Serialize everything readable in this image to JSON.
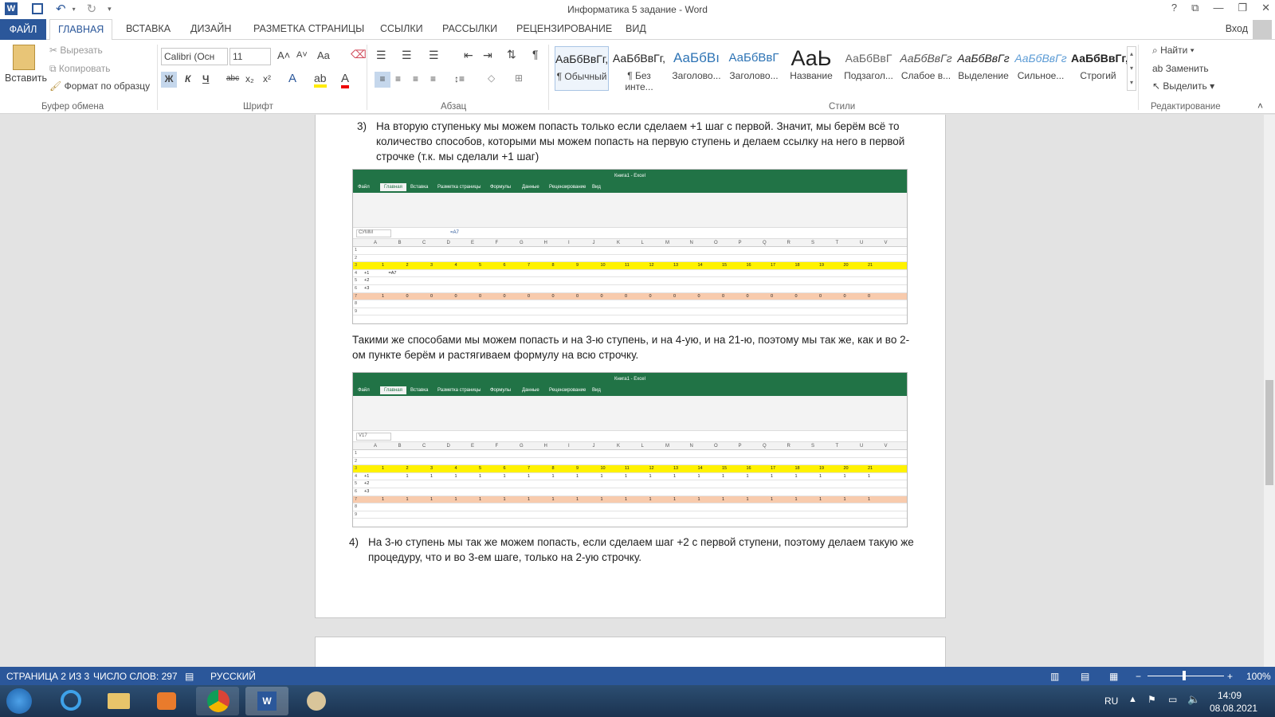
{
  "window": {
    "title": "Информатика 5 задание - Word",
    "sign_in": "Вход"
  },
  "tabs": {
    "file": "ФАЙЛ",
    "items": [
      "ГЛАВНАЯ",
      "ВСТАВКА",
      "ДИЗАЙН",
      "РАЗМЕТКА СТРАНИЦЫ",
      "ССЫЛКИ",
      "РАССЫЛКИ",
      "РЕЦЕНЗИРОВАНИЕ",
      "ВИД"
    ]
  },
  "ribbon": {
    "clipboard": {
      "paste": "Вставить",
      "cut": "Вырезать",
      "copy": "Копировать",
      "format_painter": "Формат по образцу",
      "label": "Буфер обмена"
    },
    "font": {
      "name": "Calibri (Осн",
      "size": "11",
      "label": "Шрифт",
      "bold": "Ж",
      "italic": "К",
      "underline": "Ч",
      "strike": "abc",
      "sub": "x₂",
      "sup": "x²",
      "case": "Aa"
    },
    "paragraph": {
      "label": "Абзац"
    },
    "styles": {
      "label": "Стили",
      "items": [
        {
          "preview": "АаБбВвГг,",
          "name": "¶ Обычный"
        },
        {
          "preview": "АаБбВвГг,",
          "name": "¶ Без инте..."
        },
        {
          "preview": "АаБбВı",
          "name": "Заголово..."
        },
        {
          "preview": "АаБбВвГ",
          "name": "Заголово..."
        },
        {
          "preview": "АаЬ",
          "name": "Название"
        },
        {
          "preview": "АаБбВвГ",
          "name": "Подзагол..."
        },
        {
          "preview": "АаБбВвГг",
          "name": "Слабое в..."
        },
        {
          "preview": "АаБбВвГг",
          "name": "Выделение"
        },
        {
          "preview": "АаБбВвГг",
          "name": "Сильное..."
        },
        {
          "preview": "АаБбВвГг,",
          "name": "Строгий"
        }
      ]
    },
    "editing": {
      "find": "Найти",
      "replace": "Заменить",
      "select": "Выделить",
      "label": "Редактирование"
    }
  },
  "document": {
    "item3_num": "3)",
    "item3_text": "На вторую ступеньку мы можем попасть только если сделаем +1 шаг с первой. Значит, мы берём всё то количество способов, которыми мы можем попасть на первую ступень и делаем ссылку на него в первой строчке (т.к. мы сделали +1 шаг)",
    "para_mid": "Такими же способами мы можем попасть и на 3-ю ступень, и на 4-ую, и на 21-ю, поэтому мы так же, как и во 2-ом пункте берём и растягиваем формулу на всю строчку.",
    "item4_num": "4)",
    "item4_text": "На 3-ю ступень мы так же можем попасть, если сделаем шаг +2 с первой ступени, поэтому делаем такую же процедуру, что и во 3-ем шаге, только на 2-ую строчку."
  },
  "excel1": {
    "title": "Книга1 - Excel",
    "tabs": [
      "Файл",
      "Главная",
      "Вставка",
      "Разметка страницы",
      "Формулы",
      "Данные",
      "Рецензирование",
      "Вид"
    ],
    "namebox": "СУММ",
    "formula": "=A7",
    "columns": [
      "A",
      "B",
      "C",
      "D",
      "E",
      "F",
      "G",
      "H",
      "I",
      "J",
      "K",
      "L",
      "M",
      "N",
      "O",
      "P",
      "Q",
      "R",
      "S",
      "T",
      "U",
      "V"
    ],
    "row3": [
      "1",
      "2",
      "3",
      "4",
      "5",
      "6",
      "7",
      "8",
      "9",
      "10",
      "11",
      "12",
      "13",
      "14",
      "15",
      "16",
      "17",
      "18",
      "19",
      "20",
      "21"
    ],
    "row4_label": "+1",
    "row4_b": "=A7",
    "row5_label": "+2",
    "row6_label": "+3",
    "row7": [
      "1",
      "0",
      "0",
      "0",
      "0",
      "0",
      "0",
      "0",
      "0",
      "0",
      "0",
      "0",
      "0",
      "0",
      "0",
      "0",
      "0",
      "0",
      "0",
      "0",
      "0"
    ]
  },
  "excel2": {
    "title": "Книга1 - Excel",
    "tabs": [
      "Файл",
      "Главная",
      "Вставка",
      "Разметка страницы",
      "Формулы",
      "Данные",
      "Рецензирование",
      "Вид"
    ],
    "namebox": "V17",
    "formula": "",
    "row3": [
      "1",
      "2",
      "3",
      "4",
      "5",
      "6",
      "7",
      "8",
      "9",
      "10",
      "11",
      "12",
      "13",
      "14",
      "15",
      "16",
      "17",
      "18",
      "19",
      "20",
      "21"
    ],
    "row4_label": "+1",
    "row4": [
      "1",
      "1",
      "1",
      "1",
      "1",
      "1",
      "1",
      "1",
      "1",
      "1",
      "1",
      "1",
      "1",
      "1",
      "1",
      "1",
      "1",
      "1",
      "1",
      "1"
    ],
    "row5_label": "+2",
    "row6_label": "+3",
    "row7": [
      "1",
      "1",
      "1",
      "1",
      "1",
      "1",
      "1",
      "1",
      "1",
      "1",
      "1",
      "1",
      "1",
      "1",
      "1",
      "1",
      "1",
      "1",
      "1",
      "1",
      "1"
    ]
  },
  "statusbar": {
    "page": "СТРАНИЦА 2 ИЗ 3",
    "words": "ЧИСЛО СЛОВ: 297",
    "lang": "РУССКИЙ",
    "zoom": "100%"
  },
  "taskbar": {
    "lang": "RU",
    "time": "14:09",
    "date": "08.08.2021"
  }
}
